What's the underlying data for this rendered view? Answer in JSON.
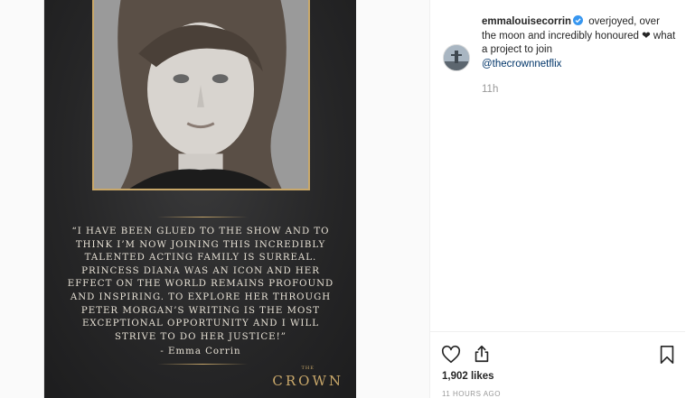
{
  "post": {
    "quote": "“I have been glued to the show and to think I’m now joining this incredibly talented acting family is surreal. Princess Diana was an icon and her effect on the world remains profound and inspiring. To explore her through Peter Morgan’s writing is the most exceptional opportunity and I will strive to do her justice!”",
    "attribution": "- Emma Corrin",
    "logo_small": "THE",
    "logo_main": "CROWN"
  },
  "caption": {
    "username": "emmalouisecorrin",
    "text": "overjoyed, over the moon and incredibly honoured ❤ what a project to join",
    "mention": "@thecrownnetflix",
    "relative_time": "11h"
  },
  "actions": {
    "likes": "1,902 likes",
    "time_ago": "11 HOURS AGO"
  },
  "colors": {
    "accent_gold": "#c9a86a",
    "link": "#003569",
    "verified": "#3897f0"
  },
  "icons": [
    "heart-icon",
    "share-icon",
    "bookmark-icon",
    "verified-icon"
  ]
}
